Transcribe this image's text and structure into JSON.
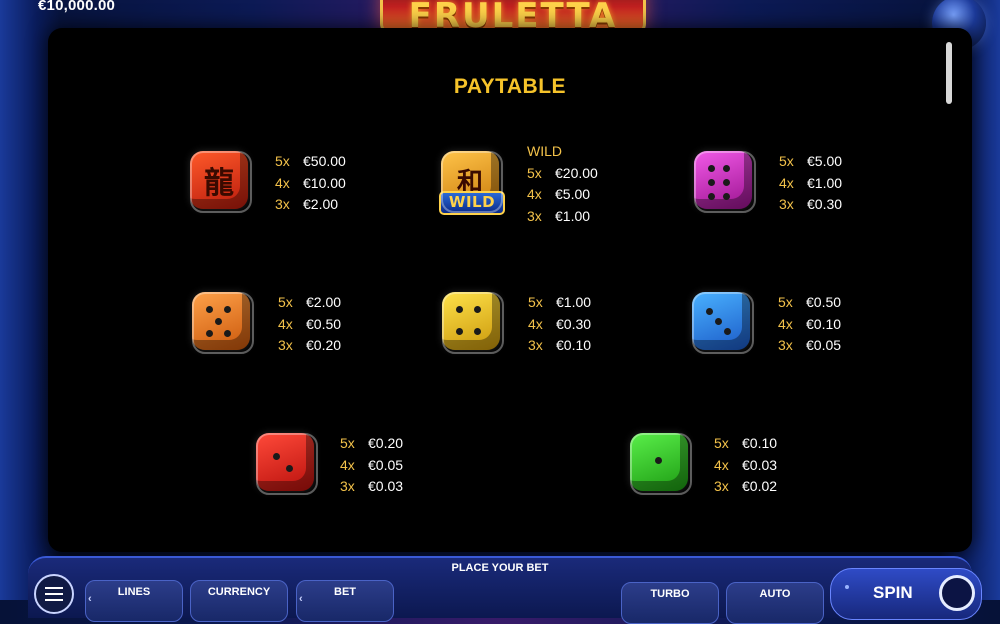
{
  "header": {
    "balance": "€10,000.00",
    "logo_text": "FRULETTA"
  },
  "paytable": {
    "title": "PAYTABLE",
    "symbols": [
      {
        "name": "red-hanzi-die",
        "wild_label": "",
        "pays": [
          {
            "mult": "5x",
            "amount": "€50.00"
          },
          {
            "mult": "4x",
            "amount": "€10.00"
          },
          {
            "mult": "3x",
            "amount": "€2.00"
          }
        ]
      },
      {
        "name": "wild-die",
        "wild_label": "WILD",
        "badge": "WILD",
        "pays": [
          {
            "mult": "5x",
            "amount": "€20.00"
          },
          {
            "mult": "4x",
            "amount": "€5.00"
          },
          {
            "mult": "3x",
            "amount": "€1.00"
          }
        ]
      },
      {
        "name": "magenta-die",
        "wild_label": "",
        "pays": [
          {
            "mult": "5x",
            "amount": "€5.00"
          },
          {
            "mult": "4x",
            "amount": "€1.00"
          },
          {
            "mult": "3x",
            "amount": "€0.30"
          }
        ]
      },
      {
        "name": "orange-die",
        "wild_label": "",
        "pays": [
          {
            "mult": "5x",
            "amount": "€2.00"
          },
          {
            "mult": "4x",
            "amount": "€0.50"
          },
          {
            "mult": "3x",
            "amount": "€0.20"
          }
        ]
      },
      {
        "name": "yellow-die",
        "wild_label": "",
        "pays": [
          {
            "mult": "5x",
            "amount": "€1.00"
          },
          {
            "mult": "4x",
            "amount": "€0.30"
          },
          {
            "mult": "3x",
            "amount": "€0.10"
          }
        ]
      },
      {
        "name": "blue-die",
        "wild_label": "",
        "pays": [
          {
            "mult": "5x",
            "amount": "€0.50"
          },
          {
            "mult": "4x",
            "amount": "€0.10"
          },
          {
            "mult": "3x",
            "amount": "€0.05"
          }
        ]
      },
      {
        "name": "red-die",
        "wild_label": "",
        "pays": [
          {
            "mult": "5x",
            "amount": "€0.20"
          },
          {
            "mult": "4x",
            "amount": "€0.05"
          },
          {
            "mult": "3x",
            "amount": "€0.03"
          }
        ]
      },
      {
        "name": "green-die",
        "wild_label": "",
        "pays": [
          {
            "mult": "5x",
            "amount": "€0.10"
          },
          {
            "mult": "4x",
            "amount": "€0.03"
          },
          {
            "mult": "3x",
            "amount": "€0.02"
          }
        ]
      }
    ]
  },
  "bottom_bar": {
    "prompt": "PLACE YOUR BET",
    "lines_label": "LINES",
    "currency_label": "CURRENCY",
    "bet_label": "BET",
    "turbo_label": "TURBO",
    "auto_label": "AUTO",
    "spin_label": "SPIN"
  },
  "colors": {
    "accent_gold": "#f6c32a",
    "die_red_hanzi": "#e23b1c",
    "die_wild": "#f2a21a",
    "die_magenta": "#d22fc8",
    "die_orange": "#f27a18",
    "die_yellow": "#f3c51e",
    "die_blue": "#2a8ae8",
    "die_red": "#e32420",
    "die_green": "#3acb2a"
  },
  "icons": [
    "menu-icon",
    "chevron-left-icon",
    "chevron-right-icon",
    "spin-refresh-icon",
    "scrollbar-thumb"
  ]
}
